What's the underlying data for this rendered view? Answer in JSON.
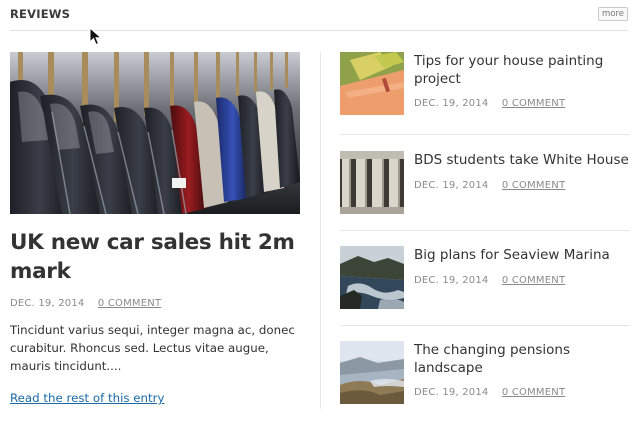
{
  "section": {
    "title": "REVIEWS",
    "more_label": "more"
  },
  "main": {
    "title": "UK new car sales hit 2m mark",
    "date": "DEC. 19, 2014",
    "comments": "0 COMMENT",
    "excerpt": "Tincidunt varius sequi, integer magna ac, donec curabitur. Rhoncus sed. Lectus vitae augue, mauris tincidunt....",
    "read_more": "Read the rest of this entry"
  },
  "side": [
    {
      "title": "Tips for your house painting project",
      "date": "DEC. 19, 2014",
      "comments": "0 COMMENT"
    },
    {
      "title": "BDS students take White House",
      "date": "DEC. 19, 2014",
      "comments": "0 COMMENT"
    },
    {
      "title": "Big plans for Seaview Marina",
      "date": "DEC. 19, 2014",
      "comments": "0 COMMENT"
    },
    {
      "title": "The changing pensions landscape",
      "date": "DEC. 19, 2014",
      "comments": "0 COMMENT"
    }
  ],
  "colors": {
    "link": "#1a6aa8",
    "meta": "#8a8a8a",
    "text": "#333333",
    "divider": "#e6e6e6"
  }
}
